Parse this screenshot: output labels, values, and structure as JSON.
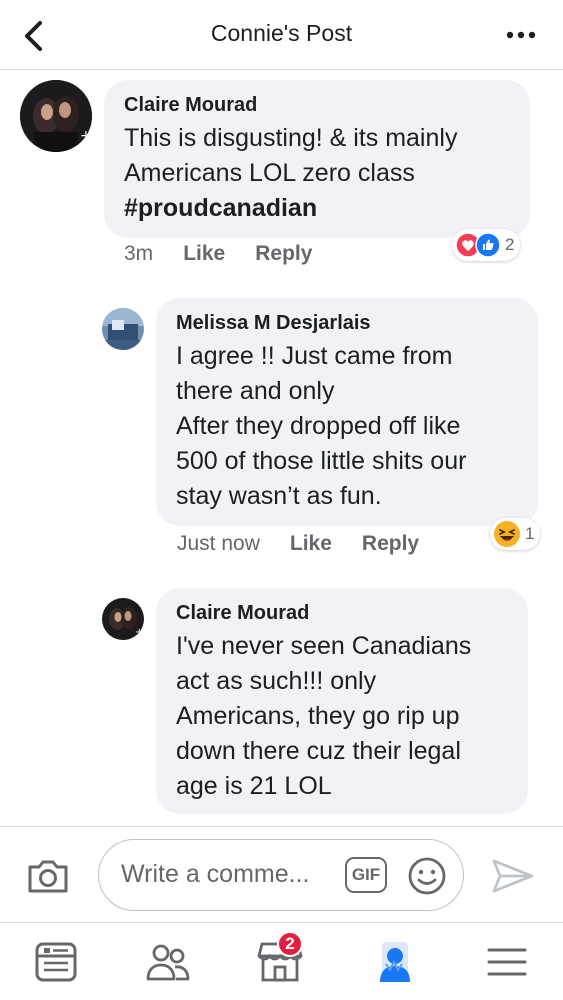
{
  "header": {
    "title": "Connie's Post"
  },
  "comments": [
    {
      "author": "Claire Mourad",
      "text": "This is disgusting! & its mainly\nAmericans LOL zero class",
      "hashtag": "#proudcanadian",
      "time": "3m",
      "like_label": "Like",
      "reply_label": "Reply",
      "reaction_count": "2"
    },
    {
      "author": "Melissa M Desjarlais",
      "text": "I agree !! Just came from\nthere and only\nAfter they dropped off like\n500 of those little shits our\nstay wasn’t as fun.",
      "time": "Just now",
      "like_label": "Like",
      "reply_label": "Reply",
      "reaction_count": "1"
    },
    {
      "author": "Claire Mourad",
      "text": "I've never seen Canadians\nact as such!!! only\nAmericans, they go rip up\ndown there cuz their legal\nage is 21 LOL"
    }
  ],
  "composer": {
    "placeholder": "Write a comme...",
    "gif_label": "GIF"
  },
  "nav": {
    "marketplace_badge": "2"
  },
  "colors": {
    "accent": "#1877f2",
    "bubble": "#f0f2f5",
    "badge": "#e41e3f"
  }
}
